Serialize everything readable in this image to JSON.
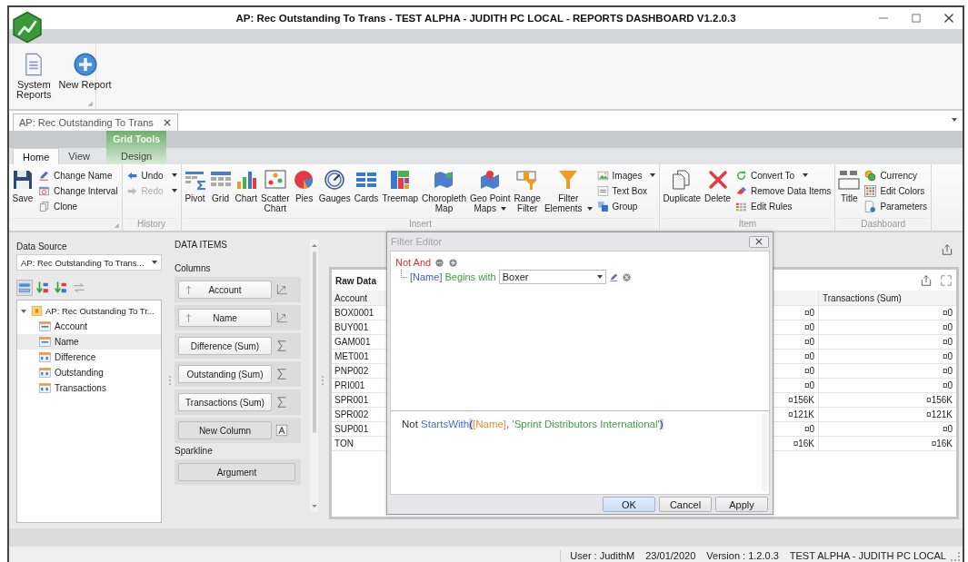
{
  "window": {
    "title": "AP: Rec Outstanding To Trans - TEST ALPHA - JUDITH PC LOCAL - REPORTS DASHBOARD V1.2.0.3"
  },
  "quick_panel": {
    "launcher": true,
    "buttons": [
      {
        "label": "System\nReports"
      },
      {
        "label": "New Report"
      }
    ]
  },
  "document_tabs": [
    {
      "label": "AP: Rec Outstanding To Trans",
      "selected": true
    }
  ],
  "ribbon_tabs": [
    {
      "label": "Home",
      "selected": true
    },
    {
      "label": "View",
      "selected": false
    },
    {
      "label": "Design",
      "selected": false,
      "context": "Grid Tools"
    }
  ],
  "ribbon_groups": [
    {
      "launcher": true,
      "items": [
        {
          "kind": "large",
          "label": "Save",
          "dropdown": false
        },
        {
          "kind": "stack",
          "buttons": [
            {
              "label": "Change Name",
              "dropdown": false,
              "disabled": false
            },
            {
              "label": "Change Interval",
              "dropdown": false,
              "disabled": false
            },
            {
              "label": "Clone",
              "dropdown": false,
              "disabled": false
            }
          ]
        }
      ]
    },
    {
      "caption": "History",
      "launcher": false,
      "items": [
        {
          "kind": "stack",
          "buttons": [
            {
              "label": "Undo",
              "dropdown": true,
              "disabled": false
            },
            {
              "label": "Redo",
              "dropdown": true,
              "disabled": true
            }
          ]
        }
      ]
    },
    {
      "caption": "Insert",
      "launcher": false,
      "items": [
        {
          "kind": "large",
          "label": "Pivot",
          "dropdown": false
        },
        {
          "kind": "large",
          "label": "Grid",
          "dropdown": false
        },
        {
          "kind": "large",
          "label": "Chart",
          "dropdown": false
        },
        {
          "kind": "large",
          "label": "Scatter\nChart",
          "dropdown": false
        },
        {
          "kind": "large",
          "label": "Pies",
          "dropdown": false
        },
        {
          "kind": "large",
          "label": "Gauges",
          "dropdown": false
        },
        {
          "kind": "large",
          "label": "Cards",
          "dropdown": false
        },
        {
          "kind": "large",
          "label": "Treemap",
          "dropdown": false
        },
        {
          "kind": "large",
          "label": "Choropleth\nMap",
          "dropdown": false
        },
        {
          "kind": "large",
          "label": "Geo Point\nMaps",
          "dropdown": true
        },
        {
          "kind": "large",
          "label": "Range\nFilter",
          "dropdown": false
        },
        {
          "kind": "large",
          "label": "Filter\nElements",
          "dropdown": true
        },
        {
          "kind": "stack",
          "buttons": [
            {
              "label": "Images",
              "dropdown": true,
              "disabled": false
            },
            {
              "label": "Text Box",
              "dropdown": false,
              "disabled": false
            },
            {
              "label": "Group",
              "dropdown": false,
              "disabled": false
            }
          ]
        }
      ]
    },
    {
      "caption": "Item",
      "launcher": false,
      "items": [
        {
          "kind": "large",
          "label": "Duplicate",
          "dropdown": false
        },
        {
          "kind": "large",
          "label": "Delete",
          "dropdown": false
        },
        {
          "kind": "stack",
          "buttons": [
            {
              "label": "Convert To",
              "dropdown": true,
              "disabled": false
            },
            {
              "label": "Remove Data Items",
              "dropdown": false,
              "disabled": false
            },
            {
              "label": "Edit Rules",
              "dropdown": false,
              "disabled": false
            }
          ]
        }
      ]
    },
    {
      "caption": "Dashboard",
      "launcher": false,
      "items": [
        {
          "kind": "large",
          "label": "Title",
          "dropdown": false
        },
        {
          "kind": "stack",
          "buttons": [
            {
              "label": "Currency",
              "dropdown": false,
              "disabled": false
            },
            {
              "label": "Edit Colors",
              "dropdown": false,
              "disabled": false
            },
            {
              "label": "Parameters",
              "dropdown": false,
              "disabled": false
            }
          ]
        }
      ]
    }
  ],
  "data_source": {
    "label": "Data Source",
    "value": "AP: Rec Outstanding To Trans...",
    "tree": {
      "label": "AP: Rec Outstanding To Tr...",
      "expanded": true,
      "children": [
        {
          "label": "Account",
          "kind": "text",
          "selected": false
        },
        {
          "label": "Name",
          "kind": "text",
          "selected": true
        },
        {
          "label": "Difference",
          "kind": "number",
          "selected": false
        },
        {
          "label": "Outstanding",
          "kind": "number",
          "selected": false
        },
        {
          "label": "Transactions",
          "kind": "number",
          "selected": false
        }
      ]
    }
  },
  "data_items": {
    "heading": "DATA ITEMS",
    "sections": [
      {
        "title": "Columns",
        "items": [
          {
            "label": "Account",
            "kind": "dimension"
          },
          {
            "label": "Name",
            "kind": "dimension"
          },
          {
            "label": "Difference (Sum)",
            "kind": "measure"
          },
          {
            "label": "Outstanding (Sum)",
            "kind": "measure"
          },
          {
            "label": "Transactions (Sum)",
            "kind": "measure"
          },
          {
            "label": "New Column",
            "kind": "new"
          }
        ]
      },
      {
        "title": "Sparkline",
        "items": [
          {
            "label": "Argument",
            "kind": "slot"
          }
        ]
      }
    ]
  },
  "grid": {
    "title": "Raw Data",
    "columns": [
      "Account",
      "Transactions (Sum)"
    ],
    "rows": [
      {
        "account": "BOX0001",
        "column_3": "¤0",
        "transactions": "¤0"
      },
      {
        "account": "BUY001",
        "column_3": "¤0",
        "transactions": "¤0"
      },
      {
        "account": "GAM001",
        "column_3": "¤0",
        "transactions": "¤0"
      },
      {
        "account": "MET001",
        "column_3": "¤0",
        "transactions": "¤0"
      },
      {
        "account": "PNP002",
        "column_3": "¤0",
        "transactions": "¤0"
      },
      {
        "account": "PRI001",
        "column_3": "¤0",
        "transactions": "¤0"
      },
      {
        "account": "SPR001",
        "column_3": "¤156K",
        "transactions": "¤156K"
      },
      {
        "account": "SPR002",
        "column_3": "¤121K",
        "transactions": "¤121K"
      },
      {
        "account": "SUP001",
        "column_3": "¤0",
        "transactions": "¤0"
      },
      {
        "account": "TON",
        "column_3": "¤16K",
        "transactions": "¤16K"
      }
    ]
  },
  "filter_editor": {
    "title": "Filter Editor",
    "group": {
      "operator": "Not And",
      "conditions": [
        {
          "field": "[Name]",
          "operation": "Begins with",
          "value": "Boxer"
        }
      ]
    },
    "expression": [
      {
        "text": "Not ",
        "kind": "keyword"
      },
      {
        "text": "StartsWith",
        "kind": "function"
      },
      {
        "text": "(",
        "kind": "bracket"
      },
      {
        "text": "[Name]",
        "kind": "field"
      },
      {
        "text": ", ",
        "kind": "plain"
      },
      {
        "text": "'Sprint Distributors International'",
        "kind": "string"
      },
      {
        "text": ")",
        "kind": "bracket"
      }
    ],
    "buttons": [
      {
        "label": "OK",
        "selected": true
      },
      {
        "label": "Cancel",
        "selected": false
      },
      {
        "label": "Apply",
        "selected": false
      }
    ]
  },
  "status_bar": [
    "User : JudithM",
    "23/01/2020",
    "Version : 1.2.0.3",
    "TEST ALPHA - JUDITH PC LOCAL"
  ]
}
